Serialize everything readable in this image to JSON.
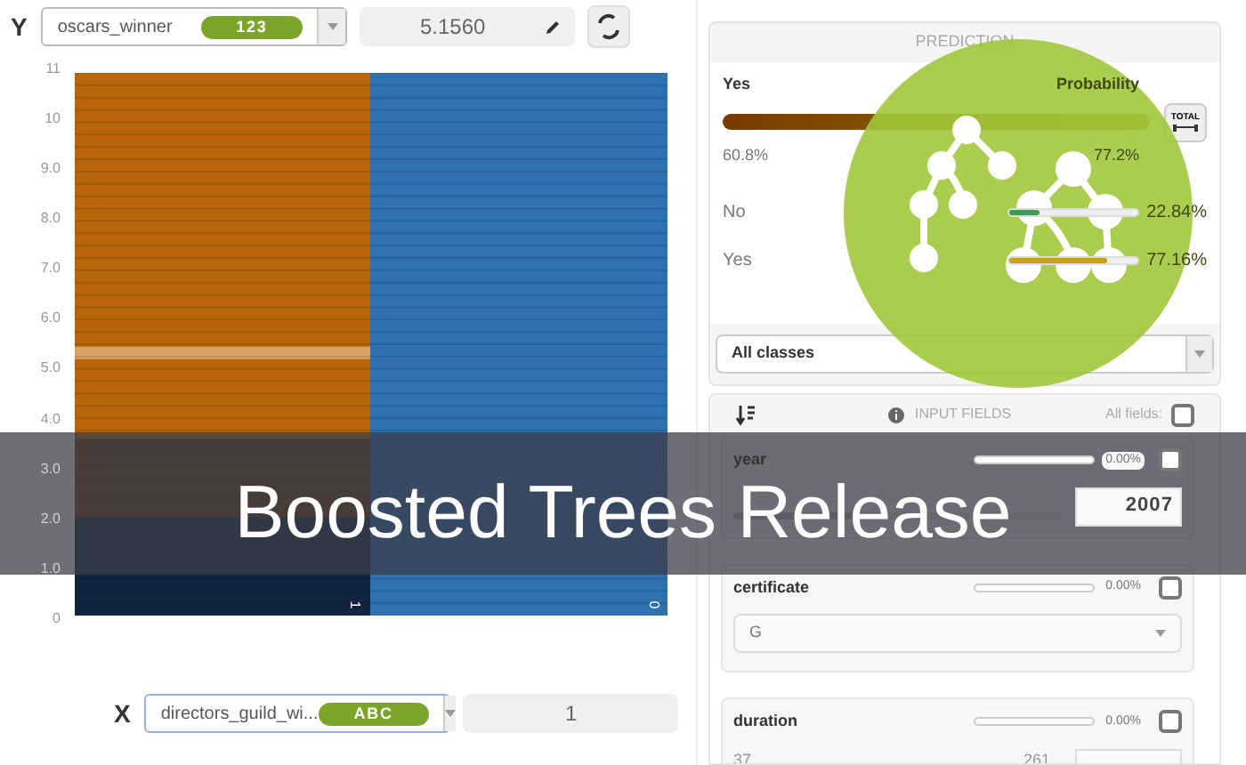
{
  "y_axis": {
    "label": "Y",
    "field": "oscars_winner",
    "type_badge": "123",
    "value": "5.1560"
  },
  "chart": {
    "yticks": [
      "11",
      "10",
      "9.0",
      "8.0",
      "7.0",
      "6.0",
      "5.0",
      "4.0",
      "3.0",
      "2.0",
      "1.0",
      "0"
    ],
    "column_labels": [
      "1",
      "0"
    ]
  },
  "x_axis": {
    "label": "X",
    "field": "directors_guild_wi...",
    "type_badge": "ABC",
    "value": "1"
  },
  "prediction": {
    "title": "PREDICTION",
    "class": "Yes",
    "probability_label": "Probability",
    "low": "60.8%",
    "high": "77.2%",
    "total_button": "TOTAL",
    "classes": [
      {
        "name": "No",
        "level": 0.23,
        "value": "22.84%",
        "color": "#3f9a55"
      },
      {
        "name": "Yes",
        "level": 0.77,
        "value": "77.16%",
        "color": "#c9a000"
      }
    ],
    "select": "All classes"
  },
  "input_fields": {
    "title": "INPUT FIELDS",
    "all_fields_label": "All fields:",
    "all_fields_checked": false,
    "fields": [
      {
        "kind": "numeric",
        "name": "year",
        "missing": "0.00%",
        "checked": false,
        "level": 0.46,
        "value": "2007"
      },
      {
        "kind": "categorical",
        "name": "certificate",
        "missing": "0.00%",
        "checked": false,
        "value": "G"
      },
      {
        "kind": "numeric",
        "name": "duration",
        "missing": "0.00%",
        "checked": false,
        "min": "37",
        "max": "261"
      }
    ]
  },
  "banner": {
    "title": "Boosted Trees Release"
  }
}
